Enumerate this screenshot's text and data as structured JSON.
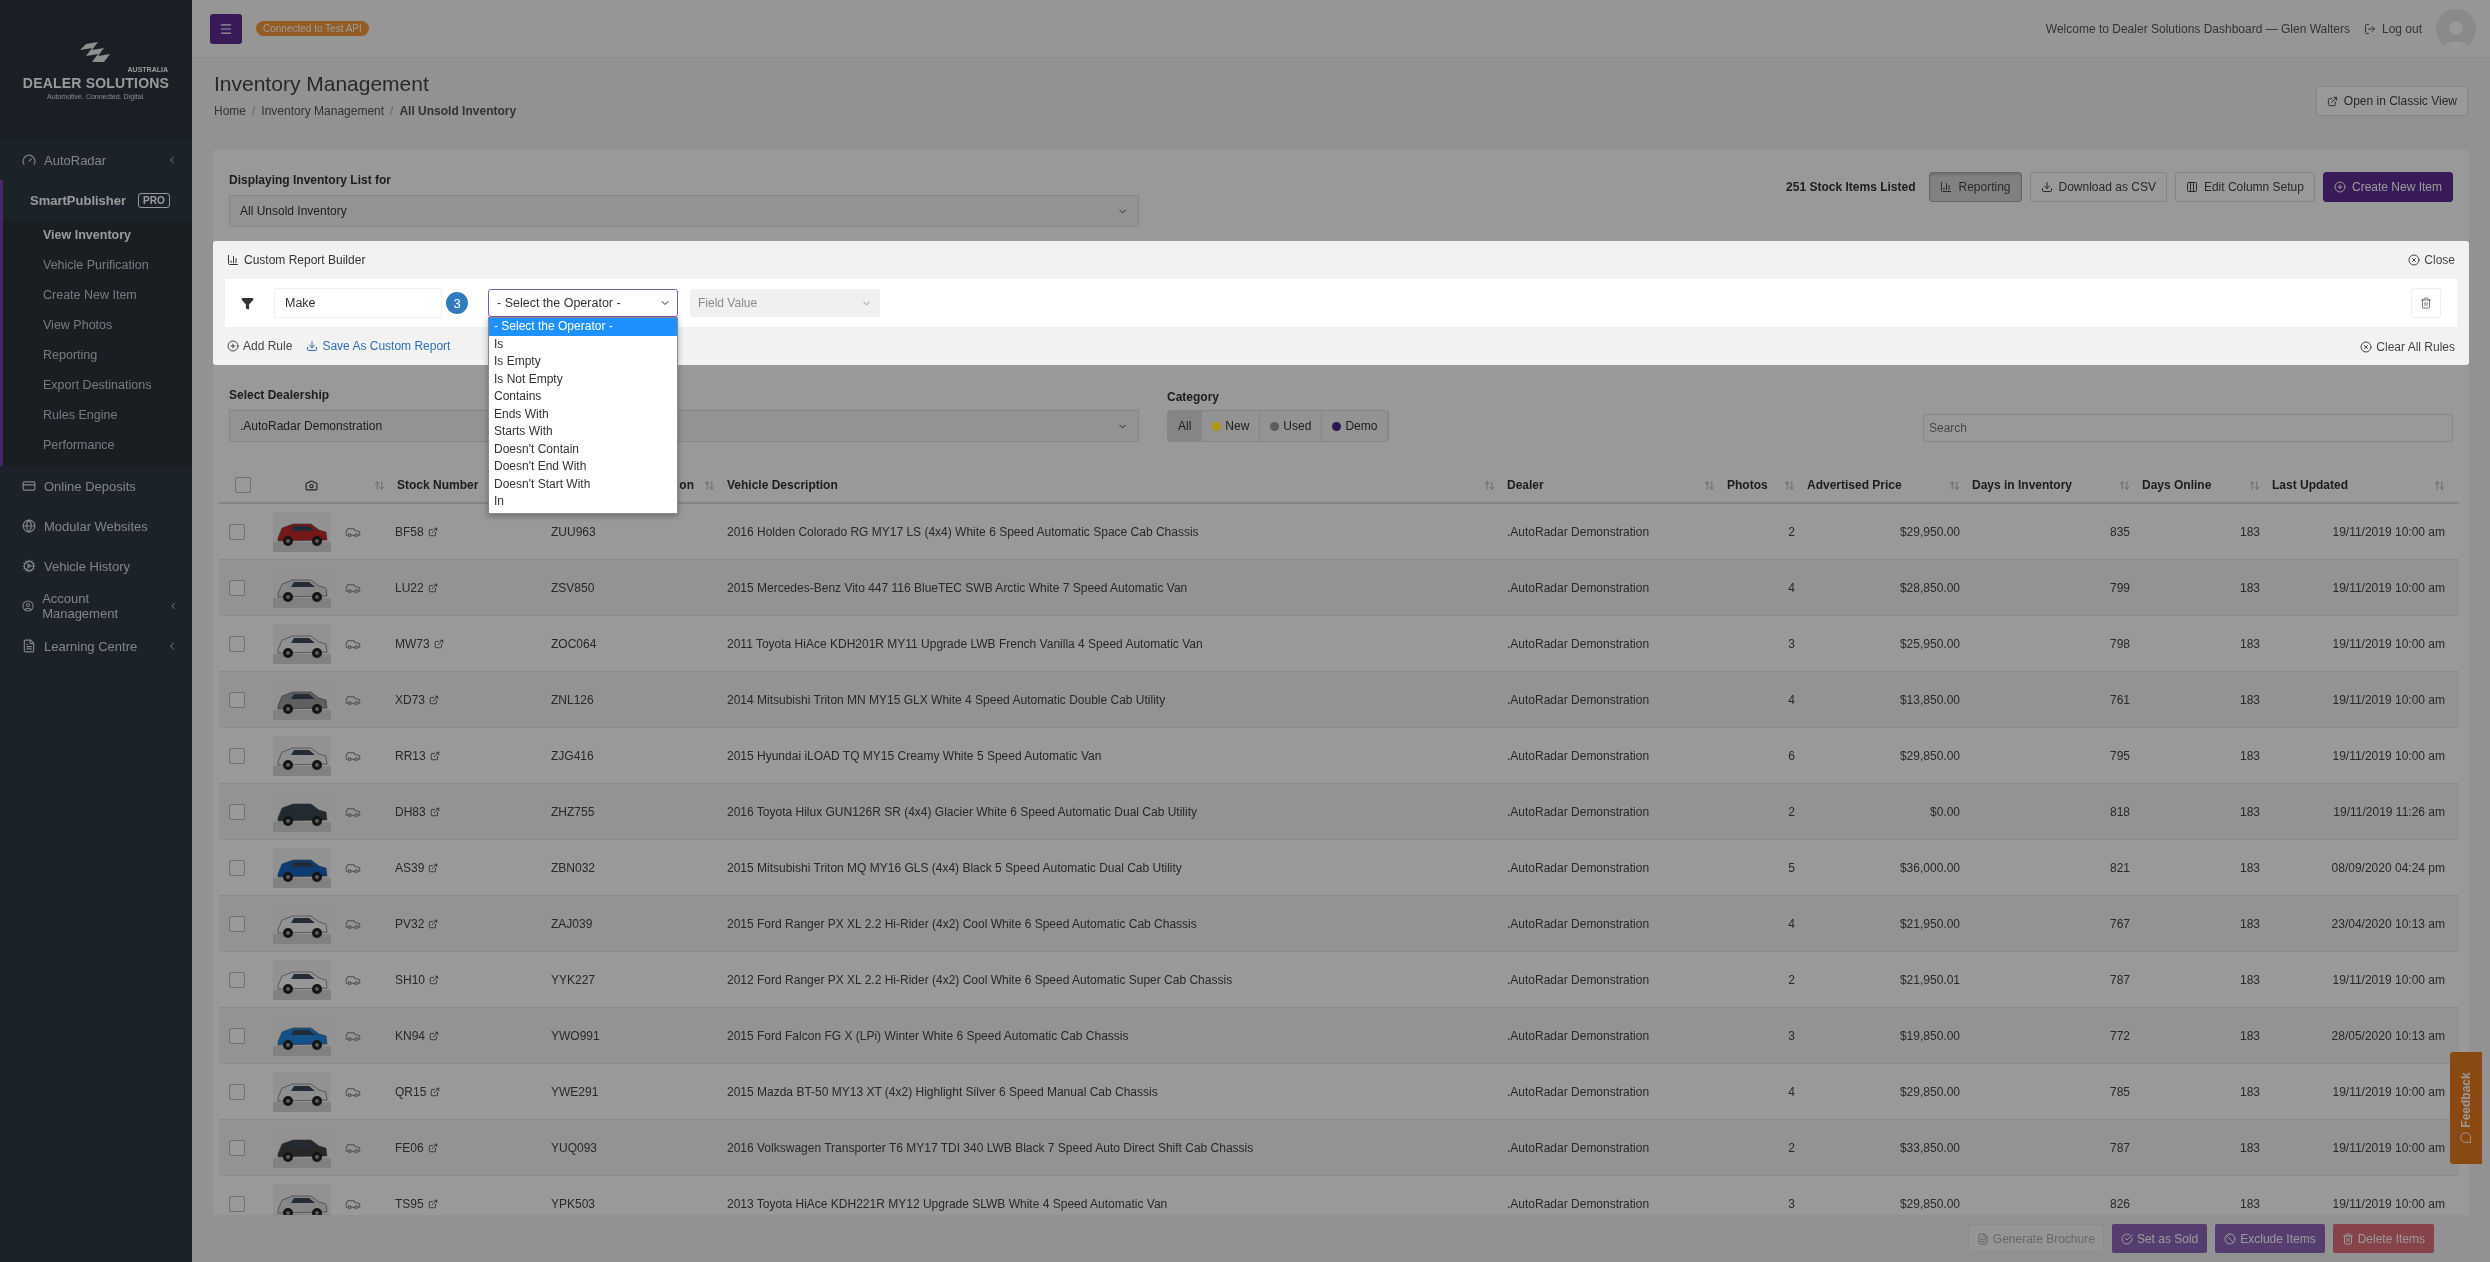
{
  "logo": {
    "region": "AUSTRALIA",
    "brand": "DEALER SOLUTIONS",
    "tagline": "Automotive. Connected. Digital."
  },
  "sidebar": {
    "items": [
      {
        "label": "AutoRadar",
        "expanded": false
      },
      {
        "label": "SmartPublisher",
        "badge": "PRO",
        "expanded": true,
        "children": [
          {
            "label": "View Inventory",
            "selected": true
          },
          {
            "label": "Vehicle Purification",
            "selected": false
          },
          {
            "label": "Create New Item",
            "selected": false
          },
          {
            "label": "View Photos",
            "selected": false
          },
          {
            "label": "Reporting",
            "selected": false
          },
          {
            "label": "Export Destinations",
            "selected": false
          },
          {
            "label": "Rules Engine",
            "selected": false
          },
          {
            "label": "Performance",
            "selected": false
          }
        ]
      },
      {
        "label": "Online Deposits"
      },
      {
        "label": "Modular Websites"
      },
      {
        "label": "Vehicle History"
      },
      {
        "label": "Account Management",
        "expanded": false
      },
      {
        "label": "Learning Centre",
        "expanded": false
      }
    ]
  },
  "topbar": {
    "api_badge": "Connected to Test API",
    "welcome": "Welcome to Dealer Solutions Dashboard — Glen Walters",
    "logout": "Log out"
  },
  "page": {
    "title": "Inventory Management",
    "breadcrumb_separator": "/",
    "breadcrumbs": [
      "Home",
      "Inventory Management",
      "All Unsold Inventory"
    ],
    "classic_view": "Open in Classic View"
  },
  "inventory": {
    "list_label": "Displaying Inventory List for",
    "list_value": "All Unsold Inventory",
    "count": "251 Stock Items Listed",
    "buttons": [
      {
        "label": "Reporting",
        "kind": "toggle",
        "selected": true
      },
      {
        "label": "Download as CSV",
        "kind": "download"
      },
      {
        "label": "Edit Column Setup",
        "kind": "columns"
      },
      {
        "label": "Create New Item",
        "kind": "primary"
      }
    ]
  },
  "report_builder": {
    "title": "Custom Report Builder",
    "close": "Close",
    "rule": {
      "field": "Make",
      "step_badge": "3",
      "operator": "- Select the Operator -",
      "value_placeholder": "Field Value"
    },
    "operator_options": [
      {
        "label": "- Select the Operator -",
        "selected": true
      },
      {
        "label": "Is",
        "selected": false
      },
      {
        "label": "Is Empty",
        "selected": false
      },
      {
        "label": "Is Not Empty",
        "selected": false
      },
      {
        "label": "Contains",
        "selected": false
      },
      {
        "label": "Ends With",
        "selected": false
      },
      {
        "label": "Starts With",
        "selected": false
      },
      {
        "label": "Doesn't Contain",
        "selected": false
      },
      {
        "label": "Doesn't End With",
        "selected": false
      },
      {
        "label": "Doesn't Start With",
        "selected": false
      },
      {
        "label": "In",
        "selected": false
      }
    ],
    "add_rule": "Add Rule",
    "save": "Save As Custom Report",
    "clear": "Clear All Rules"
  },
  "filters": {
    "dealership_label": "Select Dealership",
    "dealership_value": ".AutoRadar Demonstration",
    "category_label": "Category",
    "categories": [
      {
        "label": "All",
        "selected": true
      },
      {
        "label": "New",
        "selected": false,
        "color": "#b09608"
      },
      {
        "label": "Used",
        "selected": false,
        "color": "#5e5e5e"
      },
      {
        "label": "Demo",
        "selected": false,
        "color": "#2e1650"
      }
    ],
    "search_placeholder": "Search"
  },
  "table": {
    "select_all_checked": false,
    "columns": [
      "Stock Number",
      "on",
      "Vehicle Description",
      "Dealer",
      "Photos",
      "Advertised Price",
      "Days in Inventory",
      "Days Online",
      "Last Updated"
    ],
    "rows": [
      {
        "stock": "BF58",
        "checked": false,
        "rego": "ZUU963",
        "description": "2016 Holden Colorado RG MY17 LS (4x4) White 6 Speed Automatic Space Cab Chassis",
        "dealer": ".AutoRadar Demonstration",
        "photos": "2",
        "price": "$29,950.00",
        "days_inventory": "835",
        "days_online": "183",
        "updated": "19/11/2019 10:00 am"
      },
      {
        "stock": "LU22",
        "checked": false,
        "rego": "ZSV850",
        "description": "2015 Mercedes-Benz Vito 447 116 BlueTEC SWB Arctic White 7 Speed Automatic Van",
        "dealer": ".AutoRadar Demonstration",
        "photos": "4",
        "price": "$28,850.00",
        "days_inventory": "799",
        "days_online": "183",
        "updated": "19/11/2019 10:00 am"
      },
      {
        "stock": "MW73",
        "checked": false,
        "rego": "ZOC064",
        "description": "2011 Toyota HiAce KDH201R MY11 Upgrade LWB French Vanilla 4 Speed Automatic Van",
        "dealer": ".AutoRadar Demonstration",
        "photos": "3",
        "price": "$25,950.00",
        "days_inventory": "798",
        "days_online": "183",
        "updated": "19/11/2019 10:00 am"
      },
      {
        "stock": "XD73",
        "checked": false,
        "rego": "ZNL126",
        "description": "2014 Mitsubishi Triton MN MY15 GLX White 4 Speed Automatic Double Cab Utility",
        "dealer": ".AutoRadar Demonstration",
        "photos": "4",
        "price": "$13,850.00",
        "days_inventory": "761",
        "days_online": "183",
        "updated": "19/11/2019 10:00 am"
      },
      {
        "stock": "RR13",
        "checked": false,
        "rego": "ZJG416",
        "description": "2015 Hyundai iLOAD TQ MY15 Creamy White 5 Speed Automatic Van",
        "dealer": ".AutoRadar Demonstration",
        "photos": "6",
        "price": "$29,850.00",
        "days_inventory": "795",
        "days_online": "183",
        "updated": "19/11/2019 10:00 am"
      },
      {
        "stock": "DH83",
        "checked": false,
        "rego": "ZHZ755",
        "description": "2016 Toyota Hilux GUN126R SR (4x4) Glacier White 6 Speed Automatic Dual Cab Utility",
        "dealer": ".AutoRadar Demonstration",
        "photos": "2",
        "price": "$0.00",
        "days_inventory": "818",
        "days_online": "183",
        "updated": "19/11/2019 11:26 am"
      },
      {
        "stock": "AS39",
        "checked": false,
        "rego": "ZBN032",
        "description": "2015 Mitsubishi Triton MQ MY16 GLS (4x4) Black 5 Speed Automatic Dual Cab Utility",
        "dealer": ".AutoRadar Demonstration",
        "photos": "5",
        "price": "$36,000.00",
        "days_inventory": "821",
        "days_online": "183",
        "updated": "08/09/2020 04:24 pm"
      },
      {
        "stock": "PV32",
        "checked": false,
        "rego": "ZAJ039",
        "description": "2015 Ford Ranger PX XL 2.2 Hi-Rider (4x2) Cool White 6 Speed Automatic Cab Chassis",
        "dealer": ".AutoRadar Demonstration",
        "photos": "4",
        "price": "$21,950.00",
        "days_inventory": "767",
        "days_online": "183",
        "updated": "23/04/2020 10:13 am"
      },
      {
        "stock": "SH10",
        "checked": false,
        "rego": "YYK227",
        "description": "2012 Ford Ranger PX XL 2.2 Hi-Rider (4x2) Cool White 6 Speed Automatic Super Cab Chassis",
        "dealer": ".AutoRadar Demonstration",
        "photos": "2",
        "price": "$21,950.01",
        "days_inventory": "787",
        "days_online": "183",
        "updated": "19/11/2019 10:00 am"
      },
      {
        "stock": "KN94",
        "checked": false,
        "rego": "YWO991",
        "description": "2015 Ford Falcon FG X (LPi) Winter White 6 Speed Automatic Cab Chassis",
        "dealer": ".AutoRadar Demonstration",
        "photos": "3",
        "price": "$19,850.00",
        "days_inventory": "772",
        "days_online": "183",
        "updated": "28/05/2020 10:13 am"
      },
      {
        "stock": "QR15",
        "checked": false,
        "rego": "YWE291",
        "description": "2015 Mazda BT-50 MY13 XT (4x2) Highlight Silver 6 Speed Manual Cab Chassis",
        "dealer": ".AutoRadar Demonstration",
        "photos": "4",
        "price": "$29,850.00",
        "days_inventory": "785",
        "days_online": "183",
        "updated": "19/11/2019 10:00 am"
      },
      {
        "stock": "FE06",
        "checked": false,
        "rego": "YUQ093",
        "description": "2016 Volkswagen Transporter T6 MY17 TDI 340 LWB Black 7 Speed Auto Direct Shift Cab Chassis",
        "dealer": ".AutoRadar Demonstration",
        "photos": "2",
        "price": "$33,850.00",
        "days_inventory": "787",
        "days_online": "183",
        "updated": "19/11/2019 10:00 am"
      },
      {
        "stock": "TS95",
        "checked": false,
        "rego": "YPK503",
        "description": "2013 Toyota HiAce KDH221R MY12 Upgrade SLWB White 4 Speed Automatic Van",
        "dealer": ".AutoRadar Demonstration",
        "photos": "3",
        "price": "$29,850.00",
        "days_inventory": "826",
        "days_online": "183",
        "updated": "19/11/2019 10:00 am"
      }
    ]
  },
  "actions": [
    {
      "label": "Generate Brochure",
      "kind": "brochure",
      "disabled": true
    },
    {
      "label": "Set as Sold",
      "kind": "sold",
      "disabled": false
    },
    {
      "label": "Exclude Items",
      "kind": "exclude",
      "disabled": false
    },
    {
      "label": "Delete Items",
      "kind": "delete",
      "disabled": false
    }
  ],
  "feedback": "Feedback"
}
